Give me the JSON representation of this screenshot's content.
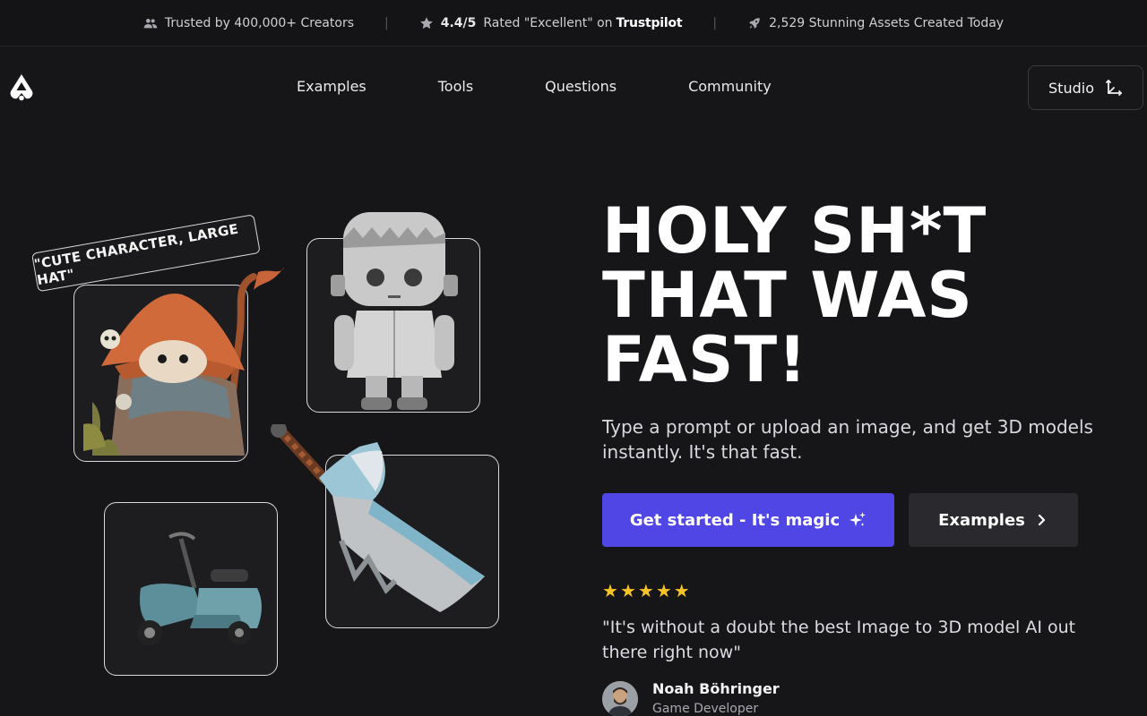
{
  "banner": {
    "trusted": "Trusted by 400,000+ Creators",
    "rating_value": "4.4/5",
    "rating_text": "Rated \"Excellent\" on",
    "rating_brand": "Trustpilot",
    "assets": "2,529 Stunning Assets Created Today",
    "separator": "|"
  },
  "nav": {
    "items": [
      "Examples",
      "Tools",
      "Questions",
      "Community"
    ],
    "studio_label": "Studio"
  },
  "gallery": {
    "prompt_label": "\"CUTE CHARACTER, LARGE HAT\""
  },
  "hero": {
    "headline_line1": "HOLY SH*T",
    "headline_line2": "THAT WAS",
    "headline_line3": "FAST!",
    "subtitle": "Type a prompt or upload an image, and get 3D models instantly. It's that fast.",
    "cta_primary": "Get started - It's magic",
    "cta_secondary": "Examples"
  },
  "testimonial": {
    "stars": 5,
    "quote": "\"It's without a doubt the best Image to 3D model AI out there right now\"",
    "author_name": "Noah Böhringer",
    "author_role": "Game Developer"
  },
  "colors": {
    "background": "#161618",
    "primary": "#4f46e5",
    "secondary": "#2a2a2e",
    "star": "#f7c325"
  }
}
